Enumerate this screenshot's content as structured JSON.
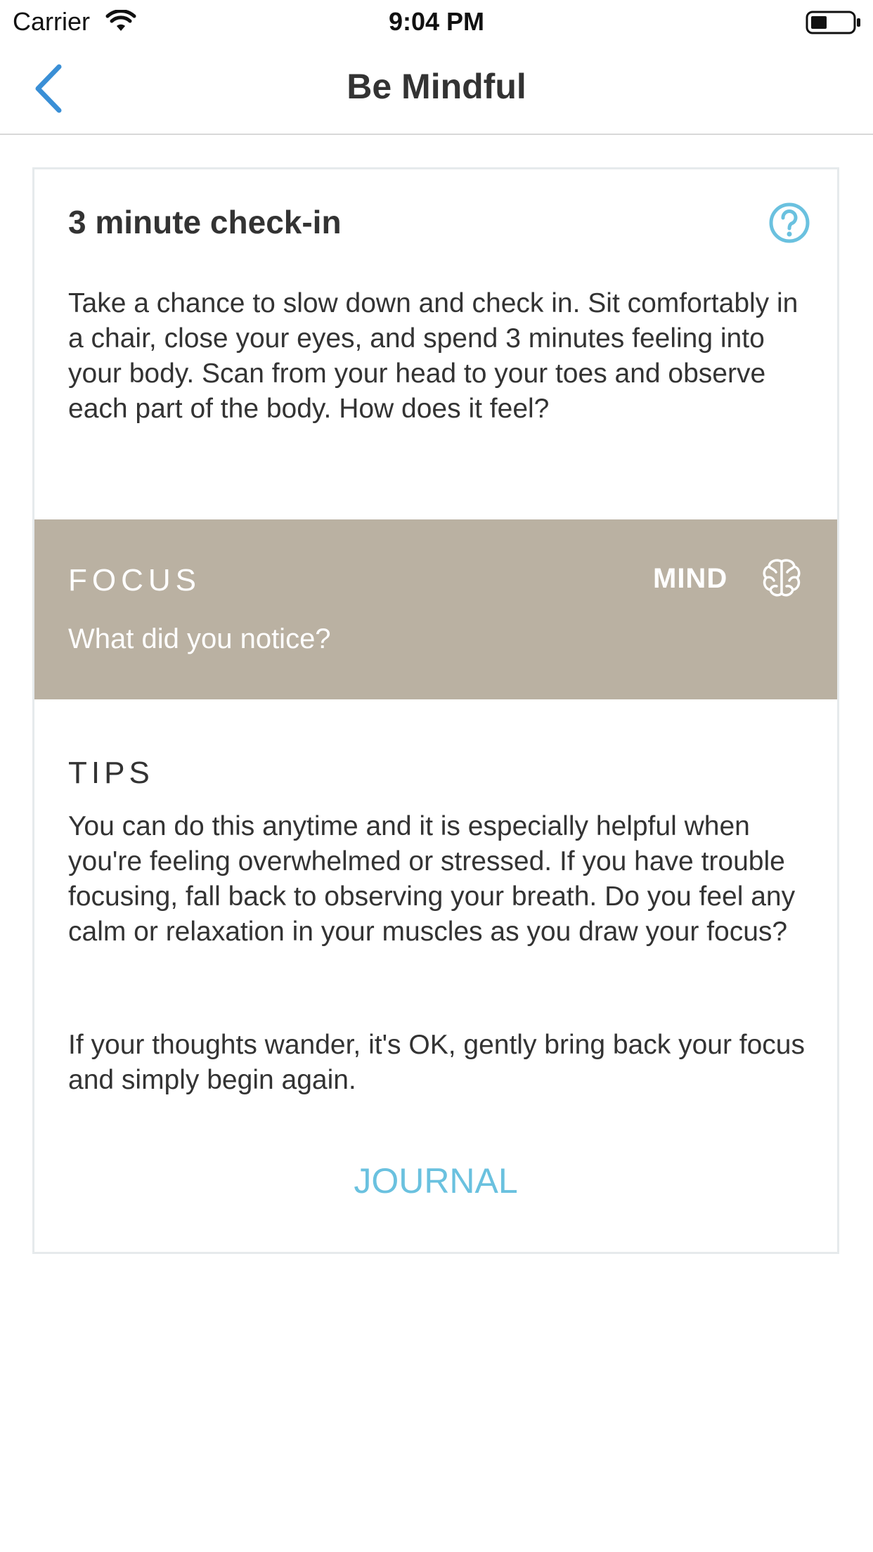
{
  "status": {
    "carrier": "Carrier",
    "time": "9:04 PM"
  },
  "nav": {
    "title": "Be Mindful",
    "back_icon": "chevron-left-icon"
  },
  "card": {
    "title": "3 minute check-in",
    "description": "Take a chance to slow down and check in. Sit comfortably in a chair, close your eyes, and spend 3 minutes feeling into your body. Scan from your head to your toes and observe each part of the body. How does it feel?",
    "focus": {
      "label": "FOCUS",
      "prompt": "What did you notice?",
      "category": "MIND",
      "background": "#bab1a2"
    },
    "tips": {
      "label": "TIPS",
      "paragraph1": "You can do this anytime and it is especially helpful when you're feeling overwhelmed or stressed. If you have trouble focusing, fall back to observing your breath. Do you feel any calm or relaxation in your muscles as you draw your focus?",
      "paragraph2": "If your thoughts wander, it's OK, gently bring back your focus and simply begin again."
    },
    "journal_label": "JOURNAL"
  },
  "colors": {
    "accent": "#6ac1df",
    "back": "#3a8fd6"
  }
}
